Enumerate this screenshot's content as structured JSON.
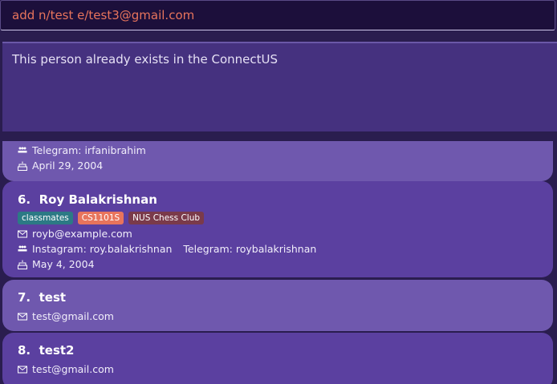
{
  "command": {
    "value": "add n/test e/test3@gmail.com"
  },
  "result": {
    "message": "This person already exists in the ConnectUS"
  },
  "partial_card": {
    "telegram": "Telegram: irfanibrahim",
    "birthday": "April 29, 2004"
  },
  "persons": [
    {
      "index": "6.",
      "name": "Roy Balakrishnan",
      "tags": [
        {
          "label": "classmates",
          "color": "#2c7a85"
        },
        {
          "label": "CS1101S",
          "color": "#e8745c"
        },
        {
          "label": "NUS Chess Club",
          "color": "#7a3a4a"
        }
      ],
      "email": "royb@example.com",
      "instagram": "Instagram: roy.balakrishnan",
      "telegram": "Telegram: roybalakrishnan",
      "birthday": "May 4, 2004"
    },
    {
      "index": "7.",
      "name": "test",
      "email": "test@gmail.com"
    },
    {
      "index": "8.",
      "name": "test2",
      "email": "test@gmail.com"
    }
  ],
  "icons": [
    "mail-icon",
    "people-icon",
    "cake-icon"
  ]
}
